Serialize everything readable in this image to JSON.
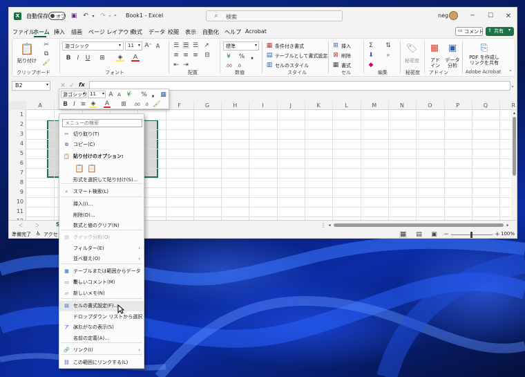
{
  "titlebar": {
    "autosave": "自動保存",
    "autosave_toggle": "オフ",
    "doc_title": "Book1 - Excel",
    "search_placeholder": "検索",
    "user": "neg"
  },
  "ribbon_tabs": [
    "ファイル",
    "ホーム",
    "挿入",
    "描画",
    "ページ レイアウト",
    "数式",
    "データ",
    "校閲",
    "表示",
    "自動化",
    "ヘルプ",
    "Acrobat"
  ],
  "comment_button": "コメント",
  "share_button": "共有",
  "ribbon": {
    "clipboard": {
      "paste": "貼り付け",
      "label": "クリップボード"
    },
    "font": {
      "name": "游ゴシック",
      "size": "11",
      "label": "フォント"
    },
    "alignment": {
      "label": "配置"
    },
    "number": {
      "format": "標準",
      "label": "数値"
    },
    "styles": {
      "cond_format": "条件付き書式",
      "table_format": "テーブルとして書式設定",
      "cell_styles": "セルのスタイル",
      "label": "スタイル"
    },
    "cells": {
      "insert": "挿入",
      "delete": "削除",
      "format": "書式",
      "label": "セル"
    },
    "editing": {
      "label": "編集"
    },
    "sensitivity": {
      "button": "秘密度",
      "label": "秘密度"
    },
    "addins": {
      "button": "アド イン",
      "label": "アドイン"
    },
    "analyze": {
      "button": "データ 分析"
    },
    "acrobat": {
      "button": "PDF を作成し リンクを共有",
      "label": "Adobe Acrobat"
    }
  },
  "formula_bar": {
    "name_box": "B2",
    "fx": "fx",
    "content": ""
  },
  "grid": {
    "columns": [
      "A",
      "B",
      "C",
      "D",
      "E",
      "F",
      "G",
      "H",
      "I",
      "J",
      "K",
      "L",
      "M",
      "N",
      "O",
      "P",
      "Q",
      "R"
    ],
    "rows": [
      "1",
      "2",
      "3",
      "4",
      "5",
      "6",
      "7",
      "8",
      "9",
      "10",
      "11",
      "12"
    ],
    "selection": "B2:E7"
  },
  "sheet_tab": "S",
  "statusbar": {
    "ready": "準備完了",
    "accessibility": "アクセシ",
    "zoom": "100%"
  },
  "mini_toolbar": {
    "font": "游ゴシック",
    "size": "11"
  },
  "context_menu": {
    "search_placeholder": "メニューの検索",
    "items": [
      {
        "label": "切り取り(T)",
        "icon": "cut-icon"
      },
      {
        "label": "コピー(C)",
        "icon": "copy-icon"
      },
      {
        "label": "貼り付けのオプション:",
        "icon": "paste-icon",
        "bold": true
      },
      {
        "label": "形式を選択して貼り付け(S)..."
      },
      {
        "label": "スマート検索(L)",
        "icon": "search-icon"
      },
      {
        "label": "挿入(I)..."
      },
      {
        "label": "削除(D)..."
      },
      {
        "label": "数式と値のクリア(N)"
      },
      {
        "label": "クイック分析(Q)",
        "disabled": true,
        "icon": "quick-analysis-icon"
      },
      {
        "label": "フィルター(E)",
        "submenu": true
      },
      {
        "label": "並べ替え(O)",
        "submenu": true
      },
      {
        "label": "テーブルまたは範囲からデータを...",
        "icon": "table-icon"
      },
      {
        "label": "新しいコメント(M)",
        "icon": "comment-icon"
      },
      {
        "label": "新しいメモ(N)",
        "icon": "note-icon"
      },
      {
        "label": "セルの書式設定(F)...",
        "icon": "format-cells-icon"
      },
      {
        "label": "ドロップダウン リストから選択(K)..."
      },
      {
        "label": "ふりがなの表示(S)",
        "icon": "furigana-icon"
      },
      {
        "label": "名前の定義(A)..."
      },
      {
        "label": "リンク(I)",
        "icon": "link-icon",
        "submenu": true
      },
      {
        "label": "この範囲にリンクする(L)",
        "icon": "link-range-icon"
      }
    ]
  }
}
